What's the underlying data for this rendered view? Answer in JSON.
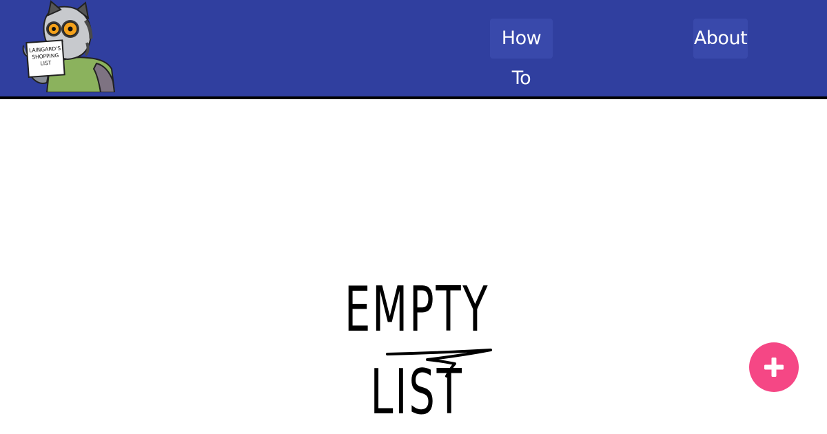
{
  "header": {
    "logo": {
      "icon": "lemur-mascot-logo",
      "sign_lines": [
        "LAINGARD'S",
        "SHOPPING",
        "LIST"
      ]
    },
    "nav": {
      "how_to_label": "How To",
      "about_label": "About"
    }
  },
  "main": {
    "empty_message": "EMPTY LIST"
  },
  "fab": {
    "icon": "plus-icon",
    "color": "#f54785"
  },
  "colors": {
    "header_bg": "#303f9f",
    "nav_button_bg": "#3949ab",
    "accent": "#f54785"
  }
}
